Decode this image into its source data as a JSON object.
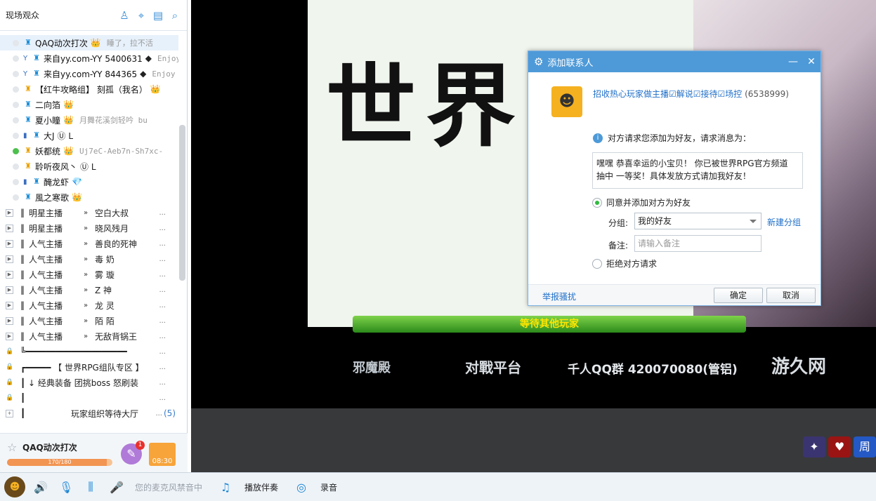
{
  "left": {
    "title": "现场观众",
    "viewers": [
      {
        "name": "QAQ动次打次",
        "badge": "👑",
        "sign": "睡了，拉不活",
        "mark": "",
        "icon": "blue",
        "online": false,
        "selected": true
      },
      {
        "name": "来自yy.com-YY 5400631",
        "badge": "◆",
        "sign": "Enjoy Y",
        "mark": "Y",
        "icon": "blue",
        "online": false,
        "selected": false
      },
      {
        "name": "来自yy.com-YY 844365",
        "badge": "◆",
        "sign": "Enjoy Y",
        "mark": "Y",
        "icon": "blue",
        "online": false,
        "selected": false
      },
      {
        "name": "【红牛攻略组】 刻孤（我名）",
        "badge": "👑",
        "sign": "",
        "mark": "",
        "icon": "gold",
        "online": false,
        "selected": false
      },
      {
        "name": "二向箔",
        "badge": "👑",
        "sign": "",
        "mark": "",
        "icon": "blue",
        "online": false,
        "selected": false
      },
      {
        "name": "夏小瞳",
        "badge": "👑",
        "sign": "月舞花溪剑轻吟  bu",
        "mark": "",
        "icon": "blue",
        "online": false,
        "selected": false
      },
      {
        "name": "大J",
        "badge": "Ⓤ L",
        "sign": "",
        "mark": "▮",
        "icon": "blue",
        "online": false,
        "selected": false
      },
      {
        "name": "妖都统",
        "badge": "👑",
        "sign": "Uj7eC-Aeb7n-Sh7xc-",
        "mark": "",
        "icon": "gold",
        "online": true,
        "selected": false
      },
      {
        "name": "聆听夜风丶",
        "badge": "Ⓤ L",
        "sign": "",
        "mark": "",
        "icon": "gold",
        "online": false,
        "selected": false
      },
      {
        "name": "醃龙虾",
        "badge": "💎",
        "sign": "",
        "mark": "▮",
        "icon": "blue",
        "online": false,
        "selected": false
      },
      {
        "name": "風之寒歌",
        "badge": "👑",
        "sign": "",
        "mark": "",
        "icon": "blue",
        "online": false,
        "selected": false
      }
    ],
    "channels": [
      {
        "type": "expand",
        "cat": "明星主播",
        "name": "空白大叔",
        "dots": "..."
      },
      {
        "type": "expand",
        "cat": "明星主播",
        "name": "晓风残月",
        "dots": "..."
      },
      {
        "type": "expand",
        "cat": "人气主播",
        "name": "善良的死神",
        "dots": "..."
      },
      {
        "type": "expand",
        "cat": "人气主播",
        "name": "毒  奶",
        "dots": "..."
      },
      {
        "type": "expand",
        "cat": "人气主播",
        "name": "雾  璇",
        "dots": "..."
      },
      {
        "type": "expand",
        "cat": "人气主播",
        "name": "Z  神",
        "dots": "..."
      },
      {
        "type": "expand",
        "cat": "人气主播",
        "name": "龙  灵",
        "dots": "..."
      },
      {
        "type": "expand",
        "cat": "人气主播",
        "name": "陌  陌",
        "dots": "..."
      },
      {
        "type": "expand",
        "cat": "人气主播",
        "name": "无敌背锅王",
        "dots": "..."
      }
    ],
    "locked_channels": [
      {
        "text": "╚━━━━━━━━━━━━━━━━━━━━",
        "dots": "..."
      },
      {
        "text": "┏━━━━━ 【 世界RPG组队专区 】",
        "dots": "..."
      },
      {
        "text": "┃   ↓ 经典装备 团挑boss 怒刷装",
        "dots": "..."
      },
      {
        "text": "┃",
        "dots": "..."
      }
    ],
    "lobby": {
      "text": "玩家组织等待大厅",
      "dots": "...",
      "count": "(5)"
    }
  },
  "profile": {
    "name": "QAQ动次打次",
    "exp_text": "170/180",
    "exp_fraction": 0.944,
    "notify_count": "1",
    "chest_timer": "08:30"
  },
  "game": {
    "big_text": "世界",
    "wait_text": "等待其他玩家",
    "strip_logo1": "邪魔殿",
    "strip_logo2": "对戰平台",
    "strip_qq": "千人QQ群 420070080(管铝)",
    "strip_logo3": "游久网"
  },
  "dialog": {
    "title": "添加联系人",
    "user_name": "招收热心玩家做主播☑解说☑接待☑场控",
    "user_id": "(6538999)",
    "info": "对方请求您添加为好友，请求消息为：",
    "message": "嘿嘿 恭喜幸运的小宝贝！ 你已被世界RPG官方频道 抽中 一等奖！具体发放方式请加我好友！",
    "accept_label": "同意并添加对方为好友",
    "group_label": "分组:",
    "group_value": "我的好友",
    "new_group": "新建分组",
    "note_label": "备注:",
    "note_placeholder": "请输入备注",
    "reject_label": "拒绝对方请求",
    "report": "举报骚扰",
    "ok": "确定",
    "cancel": "取消"
  },
  "toolbar": {
    "mic_status": "您的麦克风禁音中",
    "accompany": "播放伴奏",
    "record": "录音"
  },
  "colors": {
    "accent": "#4e9ad8",
    "link": "#1f6fc8",
    "wait_bar": "#2a8a1a"
  }
}
